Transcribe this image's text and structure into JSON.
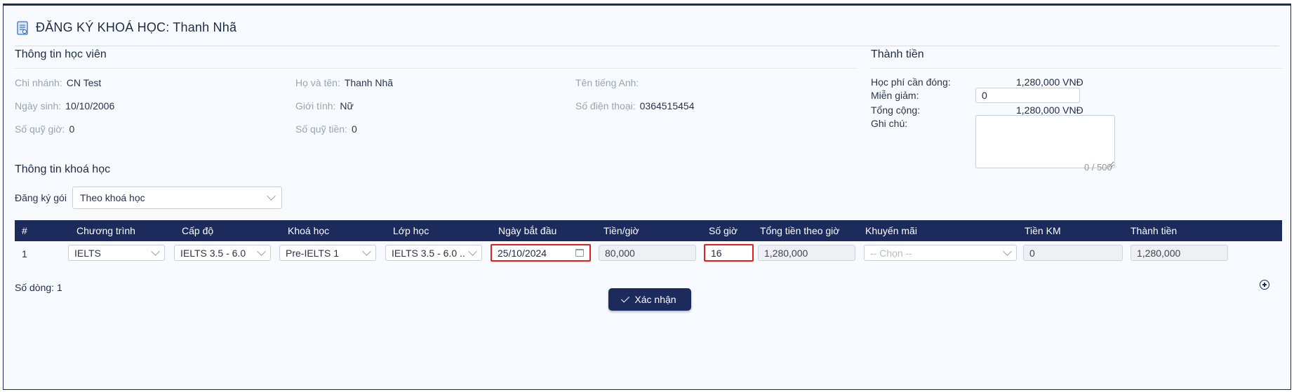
{
  "header": {
    "title": "ĐĂNG KÝ KHOÁ HỌC: Thanh Nhã"
  },
  "student": {
    "section_title": "Thông tin học viên",
    "fields": [
      {
        "label": "Chi nhánh:",
        "value": "CN Test"
      },
      {
        "label": "Họ và tên:",
        "value": "Thanh Nhã"
      },
      {
        "label": "Tên tiếng Anh:",
        "value": ""
      },
      {
        "label": "Ngày sinh:",
        "value": "10/10/2006"
      },
      {
        "label": "Giới tính:",
        "value": "Nữ"
      },
      {
        "label": "Số điện thoại:",
        "value": "0364515454"
      },
      {
        "label": "Số quỹ giờ:",
        "value": "0"
      },
      {
        "label": "Số quỹ tiền:",
        "value": "0"
      }
    ]
  },
  "summary": {
    "section_title": "Thành tiền",
    "tuition_label": "Học phí cần đóng:",
    "tuition_value": "1,280,000 VNĐ",
    "discount_label": "Miễn giảm:",
    "discount_value": "0",
    "total_label": "Tổng cộng:",
    "total_value": "1,280,000 VNĐ",
    "note_label": "Ghi chú:",
    "note_value": "",
    "note_counter": "0 / 500"
  },
  "course": {
    "section_title": "Thông tin khoá học",
    "package_label": "Đăng ký gói",
    "package_value": "Theo khoá học",
    "columns": [
      "#",
      "Chương trình",
      "Cấp độ",
      "Khoá học",
      "Lớp học",
      "Ngày bắt đầu",
      "Tiền/giờ",
      "Số giờ",
      "Tổng tiền theo giờ",
      "Khuyến mãi",
      "Tiền KM",
      "Thành tiền"
    ],
    "rows": [
      {
        "index": "1",
        "program": "IELTS",
        "level": "IELTS 3.5 - 6.0",
        "course": "Pre-IELTS 1",
        "class": "IELTS 3.5 - 6.0 ...",
        "start_date": "25/10/2024",
        "price_per_hour": "80,000",
        "hours": "16",
        "total_by_hours": "1,280,000",
        "promotion_placeholder": "-- Chọn --",
        "promotion_amount": "0",
        "amount": "1,280,000"
      }
    ],
    "row_count_label": "Số dòng: 1"
  },
  "actions": {
    "confirm_label": "Xác nhận"
  },
  "colors": {
    "primary": "#1c2a5c",
    "highlight": "#e01f1f",
    "background": "#f7fbff"
  }
}
